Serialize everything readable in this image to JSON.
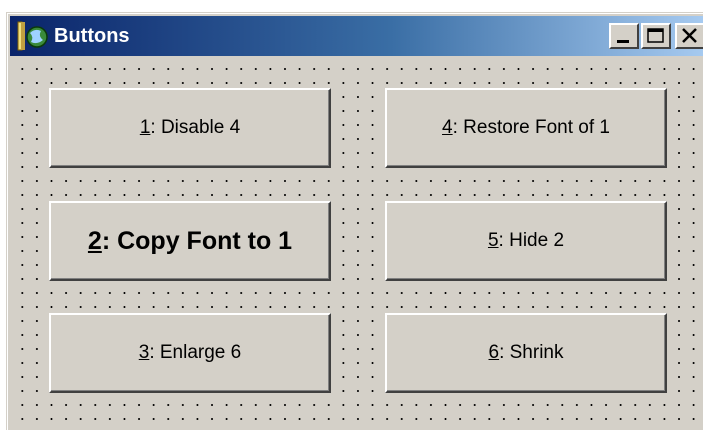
{
  "window": {
    "title": "Buttons",
    "caption_buttons": {
      "minimize": "minimize",
      "maximize": "maximize",
      "close": "close"
    }
  },
  "buttons": [
    {
      "key": "1",
      "rest": ": Disable 4",
      "bold": false
    },
    {
      "key": "2",
      "rest": ": Copy Font to 1",
      "bold": true
    },
    {
      "key": "3",
      "rest": ": Enlarge 6",
      "bold": false
    },
    {
      "key": "4",
      "rest": ": Restore Font of 1",
      "bold": false
    },
    {
      "key": "5",
      "rest": ": Hide 2",
      "bold": false
    },
    {
      "key": "6",
      "rest": ": Shrink",
      "bold": false
    }
  ],
  "colors": {
    "face": "#d4d0c8",
    "title_start": "#0a246a",
    "title_end": "#a6caf0"
  },
  "icons": {
    "app": "app-icon",
    "minimize": "minimize-icon",
    "maximize": "maximize-icon",
    "close": "close-icon"
  }
}
